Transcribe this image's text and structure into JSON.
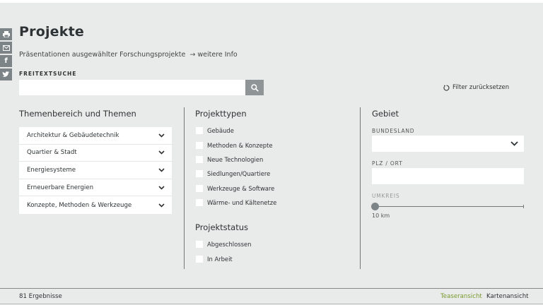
{
  "header": {
    "title": "Projekte",
    "subtitle": "Präsentationen ausgewählter Forschungsprojekte",
    "arrow": "→",
    "more_link": "weitere Info"
  },
  "share": {
    "icons": [
      "print-icon",
      "mail-icon",
      "facebook-icon",
      "twitter-icon"
    ],
    "facebook_glyph": "f"
  },
  "search": {
    "label": "FREITEXTSUCHE",
    "value": "",
    "placeholder": "",
    "reset_label": "Filter zurücksetzen"
  },
  "themes": {
    "heading": "Themenbereich und Themen",
    "items": [
      {
        "label": "Architektur & Gebäudetechnik"
      },
      {
        "label": "Quartier & Stadt"
      },
      {
        "label": "Energiesysteme"
      },
      {
        "label": "Erneuerbare Energien"
      },
      {
        "label": "Konzepte, Methoden & Werkzeuge"
      }
    ]
  },
  "types": {
    "heading": "Projekttypen",
    "items": [
      {
        "label": "Gebäude"
      },
      {
        "label": "Methoden & Konzepte"
      },
      {
        "label": "Neue Technologien"
      },
      {
        "label": "Siedlungen/Quartiere"
      },
      {
        "label": "Werkzeuge & Software"
      },
      {
        "label": "Wärme- und Kältenetze"
      }
    ]
  },
  "status": {
    "heading": "Projektstatus",
    "items": [
      {
        "label": "Abgeschlossen"
      },
      {
        "label": "In Arbeit"
      }
    ]
  },
  "region": {
    "heading": "Gebiet",
    "state_label": "BUNDESLAND",
    "state_value": "",
    "zip_label": "PLZ / ORT",
    "zip_value": "",
    "radius_label": "UMKREIS",
    "radius_value": "10 km"
  },
  "footer": {
    "results": "81 Ergebnisse",
    "view_teaser": "Teaseransicht",
    "view_map": "Kartenansicht"
  },
  "colors": {
    "background": "#e9eaea",
    "accent_green": "#7a9b2f",
    "icon_gray": "#7d8487"
  }
}
